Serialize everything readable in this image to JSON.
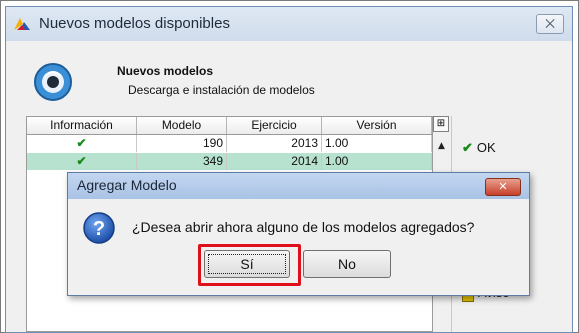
{
  "main_window": {
    "title": "Nuevos modelos disponibles",
    "close_label": "⨉",
    "header_title": "Nuevos modelos",
    "header_subtitle": "Descarga e instalación de modelos"
  },
  "table": {
    "columns": [
      "Información",
      "Modelo",
      "Ejercicio",
      "Versión"
    ],
    "rows": [
      {
        "info": "✔",
        "modelo": "190",
        "ejercicio": "2013",
        "version": "1.00"
      },
      {
        "info": "✔",
        "modelo": "349",
        "ejercicio": "2014",
        "version": "1.00"
      }
    ]
  },
  "side_buttons": {
    "ok_label": "OK",
    "other_label": "Aviso"
  },
  "dialog": {
    "title": "Agregar Modelo",
    "message": "¿Desea abrir ahora alguno de los modelos agregados?",
    "yes_label": "Sí",
    "no_label": "No"
  },
  "colors": {
    "selected_row": "#b6e2cf",
    "highlight": "#e0101a",
    "dialog_close": "#c7402a",
    "check": "#1a8a1a"
  }
}
